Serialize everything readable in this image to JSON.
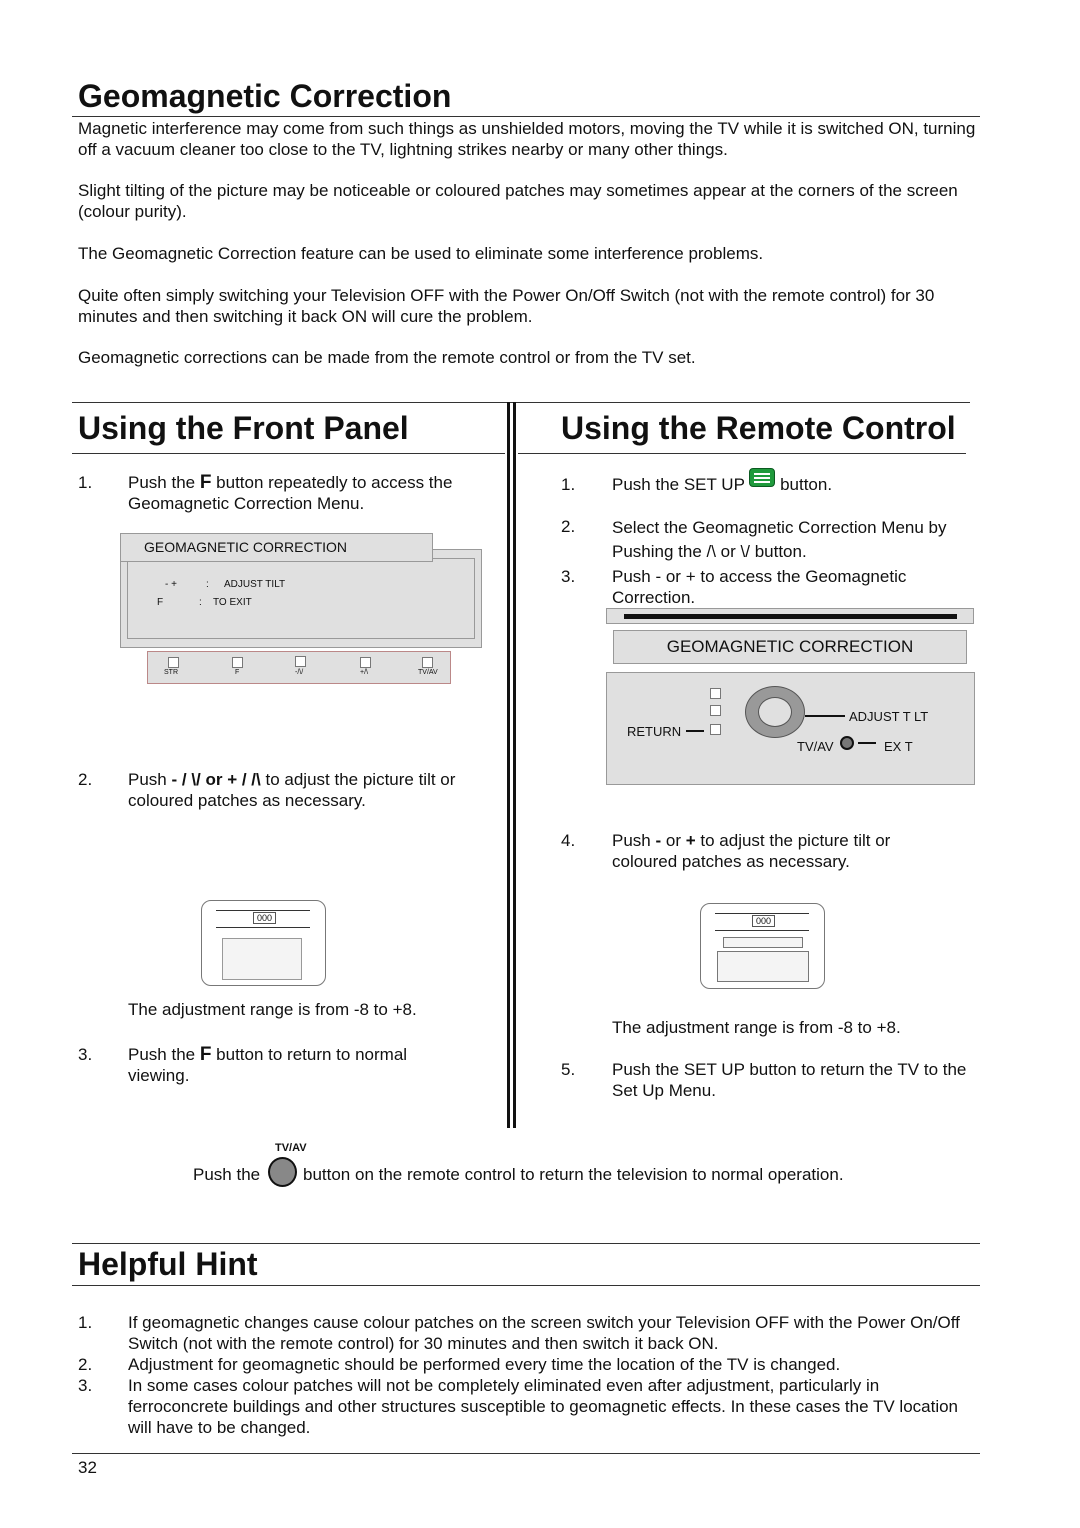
{
  "title": "Geomagnetic Correction",
  "intro": [
    "Magnetic interference may come from such things as unshielded motors, moving the TV while it is switched ON, turning off a vacuum cleaner too close to the TV, lightning strikes nearby or many other things.",
    "Slight tilting of the picture may be noticeable or coloured patches may sometimes appear at the corners of the screen (colour purity).",
    "The Geomagnetic Correction feature can be used to eliminate some interference problems.",
    "Quite often simply switching your Television OFF with the Power On/Off Switch (not with the remote control) for 30 minutes and then switching it back ON will cure the problem.",
    "Geomagnetic corrections can be made from the remote control or from the TV set."
  ],
  "front": {
    "heading": "Using the Front Panel",
    "step1_num": "1.",
    "step1_a": "Push the ",
    "step1_key": "F",
    "step1_b": " button repeatedly to access the Geomagnetic Correction Menu.",
    "osd_title": "GEOMAGNETIC CORRECTION",
    "osd_line1_key": "-  +",
    "osd_line1_sep": ":",
    "osd_line1": "ADJUST TILT",
    "osd_line2_key": "F",
    "osd_line2_sep": ":",
    "osd_line2": "TO EXIT",
    "panel_buttons": [
      "STR",
      "F",
      "-/\\/",
      "+/\\",
      "TV/AV"
    ],
    "step2_num": "2.",
    "step2_a": "Push ",
    "step2_key": "- / \\/ or + / /\\",
    "step2_b": " to adjust the picture tilt or coloured patches as necessary.",
    "mini_channel": "000",
    "range": "The adjustment range is from -8 to +8.",
    "step3_num": "3.",
    "step3_a": "Push the ",
    "step3_key": "F",
    "step3_b": " button to return to normal viewing."
  },
  "remote": {
    "heading": "Using the Remote Control",
    "step1_num": "1.",
    "step1_a": "Push the SET UP ",
    "step1_b": " button.",
    "step2_num": "2.",
    "step2": "Select the Geomagnetic Correction Menu by Pushing the /\\ or \\/  button.",
    "step3_num": "3.",
    "step3": "Push - or + to access the Geomagnetic Correction.",
    "osd_title": "GEOMAGNETIC CORRECTION",
    "return_label": "RETURN",
    "adjust_label": "ADJUST T LT",
    "tvav_label": "TV/AV",
    "exit_label": "EX T",
    "step4_num": "4.",
    "step4_a": "Push ",
    "step4_minus": "-",
    "step4_b": " or ",
    "step4_plus": "+",
    "step4_c": " to adjust the picture tilt or coloured patches as necessary.",
    "mini_channel": "000",
    "range": "The adjustment range is from -8 to +8.",
    "step5_num": "5.",
    "step5": "Push the SET UP button to return the TV to the Set Up Menu.",
    "setup_color": "#1f9a3c"
  },
  "footer_note": {
    "label": "TV/AV",
    "a": "Push the",
    "b": " button on the remote control to return the television to normal operation."
  },
  "hint": {
    "heading": "Helpful Hint",
    "items": [
      {
        "num": "1.",
        "text": "If geomagnetic changes cause colour patches on the screen switch your Television OFF with the Power On/Off Switch (not with the remote control) for 30 minutes and then switch it back ON."
      },
      {
        "num": "2.",
        "text": "Adjustment for geomagnetic should be performed every time the location of the TV is changed."
      },
      {
        "num": "3.",
        "text": "In some cases colour patches will not be completely eliminated even after adjustment, particularly in ferroconcrete buildings and other structures susceptible to geomagnetic effects. In these cases the TV location will have to be changed."
      }
    ]
  },
  "page_number": "32"
}
